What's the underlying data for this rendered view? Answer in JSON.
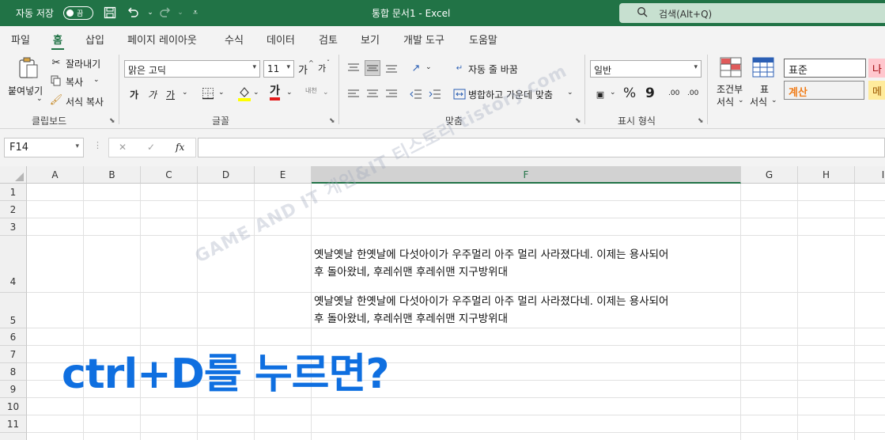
{
  "titlebar": {
    "autosave_label": "자동 저장",
    "autosave_state": "끔",
    "doc_title": "통합 문서1  -  Excel",
    "search_placeholder": "검색(Alt+Q)"
  },
  "tabs": [
    {
      "label": "파일"
    },
    {
      "label": "홈"
    },
    {
      "label": "삽입"
    },
    {
      "label": "페이지 레이아웃"
    },
    {
      "label": "수식"
    },
    {
      "label": "데이터"
    },
    {
      "label": "검토"
    },
    {
      "label": "보기"
    },
    {
      "label": "개발 도구"
    },
    {
      "label": "도움말"
    }
  ],
  "active_tab": "홈",
  "ribbon": {
    "clipboard": {
      "paste": "붙여넣기",
      "cut": "잘라내기",
      "copy": "복사",
      "format_painter": "서식 복사",
      "group": "클립보드"
    },
    "font": {
      "font_name": "맑은 고딕",
      "font_size": "11",
      "grow": "가",
      "shrink": "가",
      "bold": "가",
      "italic": "가",
      "underline": "가",
      "font_color_glyph": "가",
      "phonetic": "내천",
      "group": "글꼴"
    },
    "alignment": {
      "wrap_text": "자동 줄 바꿈",
      "merge_center": "병합하고 가운데 맞춤",
      "group": "맞춤"
    },
    "number": {
      "format": "일반",
      "percent": "%",
      "comma": "9",
      "dec_inc": ".00",
      "dec_dec": ".00",
      "group": "표시 형식"
    },
    "styles": {
      "conditional": [
        "조건부",
        "서식"
      ],
      "table": [
        "표",
        "서식"
      ],
      "normal": "표준",
      "calculation": "계산",
      "bad": "나",
      "neutral": "메"
    }
  },
  "formula_bar": {
    "name_box": "F14",
    "cancel": "✕",
    "enter": "✓",
    "fx": "fx",
    "content": ""
  },
  "grid": {
    "columns": [
      "A",
      "B",
      "C",
      "D",
      "E",
      "F",
      "G",
      "H",
      "I"
    ],
    "selected_column": "F",
    "rows": [
      "1",
      "2",
      "3",
      "4",
      "5",
      "6",
      "7",
      "8",
      "9",
      "10",
      "11"
    ],
    "cells": {
      "F4": [
        "옛날옛날 한옛날에 다섯아이가 우주멀리 아주 멀리 사라졌다네. 이제는 용사되어",
        "후 돌아왔네, 후레쉬맨 후레쉬맨 지구방위대"
      ],
      "F5": [
        "옛날옛날 한옛날에 다섯아이가 우주멀리 아주 멀리 사라졌다네. 이제는 용사되어",
        "후 돌아왔네, 후레쉬맨 후레쉬맨 지구방위대"
      ]
    }
  },
  "watermark": "GAME AND IT 게임&IT 티스토리 tistory.com",
  "overlay_text": "ctrl+D를 누르면?",
  "colors": {
    "excel_green": "#217346",
    "overlay_blue": "#0f6fe0"
  }
}
